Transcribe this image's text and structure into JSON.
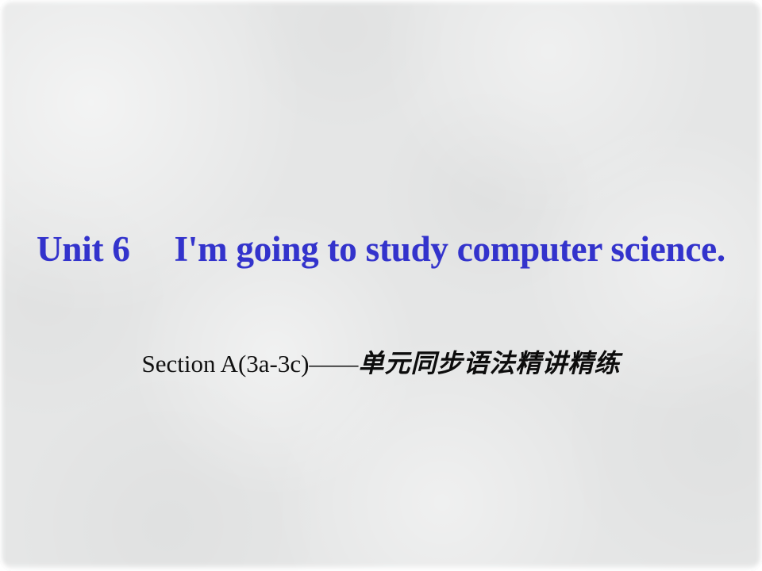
{
  "slide": {
    "background_color": "#E5E6E6",
    "accent_color": "#3333CC",
    "text_color": "#111111",
    "title": "Unit 6  I'm going to study computer science.",
    "subtitle_en": "Section A(3a-3c)——",
    "subtitle_cn": "单元同步语法精讲精练"
  }
}
